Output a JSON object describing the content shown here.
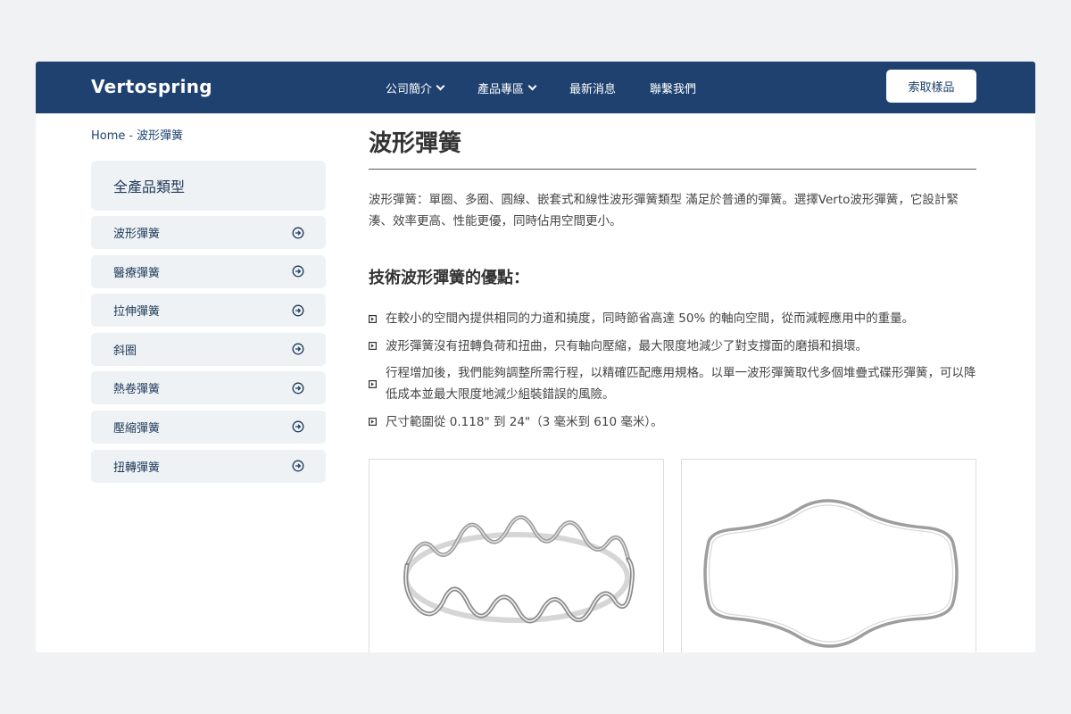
{
  "header": {
    "brand": "Vertospring",
    "nav": [
      {
        "label": "公司簡介",
        "has_dropdown": true
      },
      {
        "label": "產品專區",
        "has_dropdown": true
      },
      {
        "label": "最新消息",
        "has_dropdown": false
      },
      {
        "label": "聯繫我們",
        "has_dropdown": false
      }
    ],
    "cta_label": "索取樣品"
  },
  "breadcrumb": {
    "home": "Home",
    "separator": "-",
    "current": "波形彈簧"
  },
  "sidebar": {
    "title": "全產品類型",
    "items": [
      {
        "label": "波形彈簧",
        "icon": "circle-arrow-right-icon"
      },
      {
        "label": "醫療彈簧",
        "icon": "circle-arrow-right-icon"
      },
      {
        "label": "拉伸彈簧",
        "icon": "circle-arrow-right-icon"
      },
      {
        "label": "斜圈",
        "icon": "circle-arrow-right-icon"
      },
      {
        "label": "熱卷彈簧",
        "icon": "circle-arrow-right-icon"
      },
      {
        "label": "壓縮彈簧",
        "icon": "circle-arrow-right-icon"
      },
      {
        "label": "扭轉彈簧",
        "icon": "circle-arrow-right-icon"
      }
    ]
  },
  "main": {
    "title": "波形彈簧",
    "intro": "波形彈簧：單圈、多圈、圓線、嵌套式和線性波形彈簧類型 滿足於普通的彈簧。選擇Verto波形彈簧，它設計緊湊、效率更高、性能更優，同時佔用空間更小。",
    "benefits_heading": "技術波形彈簧的優點：",
    "benefits": [
      "在較小的空間內提供相同的力道和撓度，同時節省高達 50% 的軸向空間，從而減輕應用中的重量。",
      "波形彈簧沒有扭轉負荷和扭曲，只有軸向壓縮，最大限度地減少了對支撐面的磨損和損壞。",
      "行程增加後，我們能夠調整所需行程，以精確匹配應用規格。以單一波形彈簧取代多個堆疊式碟形彈簧，可以降低成本並最大限度地減少組裝錯誤的風險。",
      "尺寸範圍從 0.118\" 到 24\"（3 毫米到 610 毫米）。"
    ]
  },
  "colors": {
    "header_bg": "#1e4170",
    "sidebar_bg": "#eef2f5",
    "accent_text": "#1e4170"
  }
}
